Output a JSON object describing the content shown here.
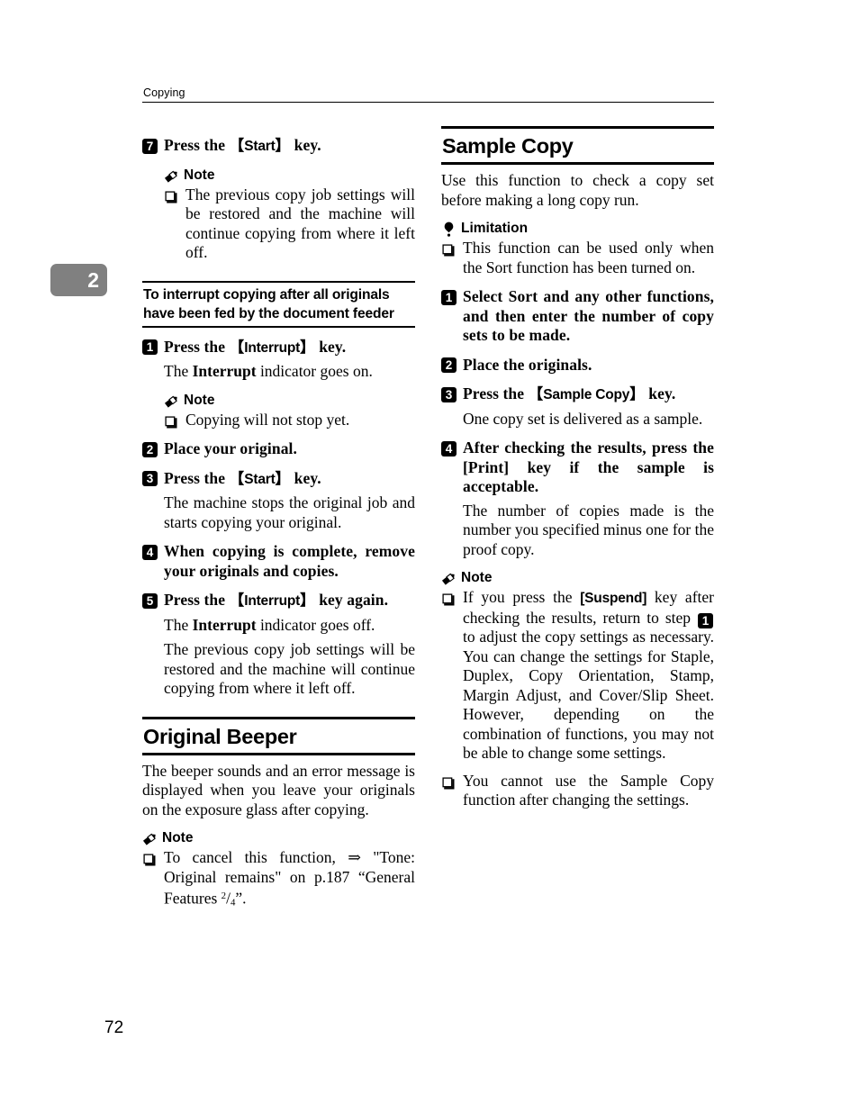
{
  "page": {
    "running_header": "Copying",
    "folio": "72",
    "chapter_tab": "2",
    "chapter_tab_color": "#808080"
  },
  "left_column": {
    "step7": {
      "num": "7",
      "text_before_key": "Press the ",
      "key": "Start",
      "text_after_key": " key."
    },
    "note1": {
      "label": "Note",
      "icon": "pencil-icon",
      "items": [
        "The previous copy job settings will be restored and the machine will continue copying from where it left off."
      ]
    },
    "subsection": {
      "title": "To interrupt copying after all originals have been fed by the document feeder"
    },
    "step1": {
      "num": "1",
      "text_before_key": "Press the ",
      "key": "Interrupt",
      "text_after_key": " key."
    },
    "step1_body_a": "The ",
    "step1_body_bold": "Interrupt",
    "step1_body_b": " indicator goes on.",
    "note2": {
      "label": "Note",
      "icon": "pencil-icon",
      "items": [
        "Copying will not stop yet."
      ]
    },
    "step2": {
      "num": "2",
      "text": "Place your original."
    },
    "step3": {
      "num": "3",
      "text_before_key": "Press the ",
      "key": "Start",
      "text_after_key": " key."
    },
    "step3_body": "The machine stops the original job and starts copying your original.",
    "step4": {
      "num": "4",
      "text": "When copying is complete, remove your originals and copies."
    },
    "step5": {
      "num": "5",
      "text_before_key": "Press the ",
      "key": "Interrupt",
      "text_after_key": " key again."
    },
    "step5_body_a": "The ",
    "step5_body_bold": "Interrupt",
    "step5_body_b": " indicator goes off.",
    "step5_body2": "The previous copy job settings will be restored and the machine will continue copying from where it left off.",
    "section": {
      "title": "Original Beeper"
    },
    "section_intro": "The beeper sounds and an error message is displayed when you leave your originals on the exposure glass after copying.",
    "note3": {
      "label": "Note",
      "icon": "pencil-icon",
      "item_part1": "To cancel this function, ",
      "arrow": "⇒",
      "item_part2": " \"Tone: Original remains\" on p.187 “General Features ",
      "fn_sup": "2",
      "fn_slash": "/",
      "fn_sub": "4",
      "item_part3": "”."
    }
  },
  "right_column": {
    "section": {
      "title": "Sample Copy"
    },
    "section_intro": "Use this function to check a copy set before making a long copy run.",
    "limitation": {
      "label": "Limitation",
      "icon": "balloon-icon",
      "items": [
        "This function can be used only when the Sort function has been turned on."
      ]
    },
    "step1": {
      "num": "1",
      "text": "Select Sort and any other functions, and then enter the number of copy sets to be made."
    },
    "step2": {
      "num": "2",
      "text": "Place the originals."
    },
    "step3": {
      "num": "3",
      "text_before_key": "Press the ",
      "key": "Sample Copy",
      "text_after_key": " key."
    },
    "step3_body": "One copy set is delivered as a sample.",
    "step4": {
      "num": "4",
      "text": "After checking the results, press the [Print] key if the sample is acceptable."
    },
    "step4_body": "The number of copies made is the number you specified minus one for the proof copy.",
    "note": {
      "label": "Note",
      "icon": "pencil-icon",
      "item1_part1": "If you press the ",
      "item1_key": "[Suspend]",
      "item1_part2": " key after checking the results, return to step ",
      "item1_step_badge": "1",
      "item1_part3": " to adjust the copy settings as necessary. You can change the settings for Staple, Duplex, Copy Orientation, Stamp, Margin Adjust, and Cover/Slip Sheet. However, depending on the combination of functions, you may not be able to change some settings.",
      "item2": "You cannot use the Sample Copy function after changing the settings."
    }
  }
}
